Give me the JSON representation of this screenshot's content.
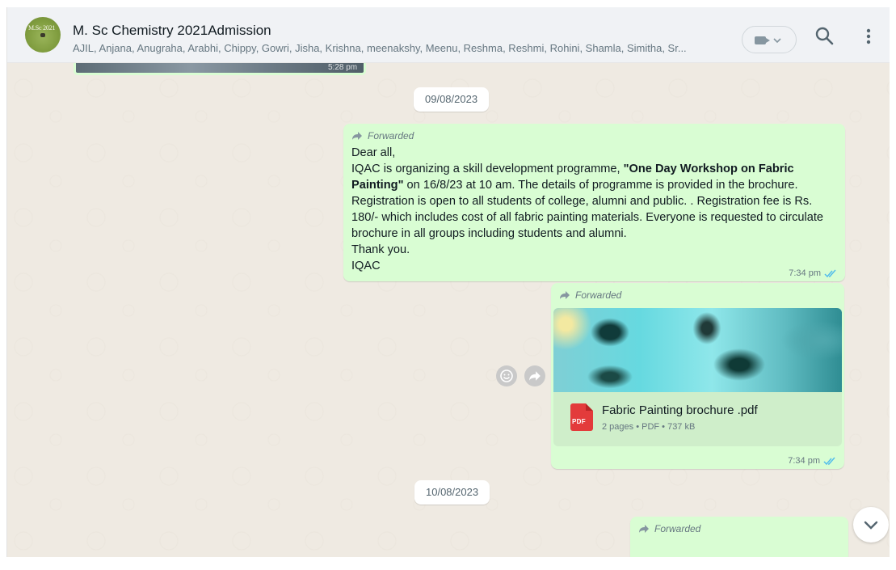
{
  "header": {
    "avatar_text": "M.Sc 2021",
    "title": "M. Sc Chemistry 2021Admission",
    "members": "AJIL, Anjana, Anugraha, Arabhi, Chippy, Gowri, Jisha, Krishna, meenakshy, Meenu, Reshma, Reshmi, Rohini, Shamla, Simitha, Sr...",
    "icons": [
      "video-call-icon",
      "chevron-down-icon",
      "search-icon",
      "more-options-icon"
    ]
  },
  "previous_message": {
    "time": "5:28 pm"
  },
  "dates": [
    "09/08/2023",
    "10/08/2023"
  ],
  "messages": [
    {
      "forwarded_label": "Forwarded",
      "lines": [
        "Dear all,",
        "IQAC is organizing a skill development programme, ",
        "\"One Day Workshop on Fabric Painting\"",
        " on 16/8/23 at 10 am. The details of programme is provided in the brochure. Registration is open to all students of college, alumni and public. . Registration fee is Rs. 180/- which includes cost of all fabric painting materials. Everyone is requested to circulate brochure in all groups including students and alumni.",
        "Thank you.",
        "IQAC"
      ],
      "time": "7:34 pm"
    },
    {
      "forwarded_label": "Forwarded",
      "document": {
        "type_label": "PDF",
        "name": "Fabric Painting brochure .pdf",
        "info": "2 pages • PDF • 737 kB"
      },
      "time": "7:34 pm"
    },
    {
      "forwarded_label": "Forwarded"
    }
  ],
  "colors": {
    "bubble_out": "#d9fdd3",
    "chat_bg": "#efeae2",
    "tick_read": "#53bdeb",
    "pdf_red": "#e33b3b"
  }
}
